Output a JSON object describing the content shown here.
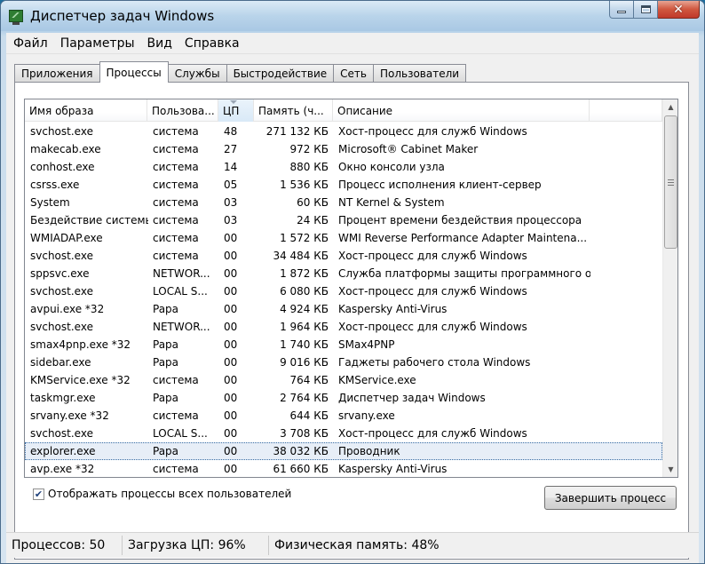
{
  "window": {
    "title": "Диспетчер задач Windows"
  },
  "menu": [
    "Файл",
    "Параметры",
    "Вид",
    "Справка"
  ],
  "tabs": [
    {
      "label": "Приложения"
    },
    {
      "label": "Процессы",
      "active": true
    },
    {
      "label": "Службы"
    },
    {
      "label": "Быстродействие"
    },
    {
      "label": "Сеть"
    },
    {
      "label": "Пользователи"
    }
  ],
  "columns": [
    "Имя образа",
    "Пользова...",
    "ЦП",
    "Память (ч...",
    "Описание"
  ],
  "processes": [
    {
      "name": "svchost.exe",
      "user": "система",
      "cpu": "48",
      "mem": "271 132 КБ",
      "desc": "Хост-процесс для служб Windows"
    },
    {
      "name": "makecab.exe",
      "user": "система",
      "cpu": "27",
      "mem": "972 КБ",
      "desc": "Microsoft® Cabinet Maker"
    },
    {
      "name": "conhost.exe",
      "user": "система",
      "cpu": "14",
      "mem": "880 КБ",
      "desc": "Окно консоли узла"
    },
    {
      "name": "csrss.exe",
      "user": "система",
      "cpu": "05",
      "mem": "1 536 КБ",
      "desc": "Процесс исполнения клиент-сервер"
    },
    {
      "name": "System",
      "user": "система",
      "cpu": "03",
      "mem": "60 КБ",
      "desc": "NT Kernel & System"
    },
    {
      "name": "Бездействие системы",
      "user": "система",
      "cpu": "03",
      "mem": "24 КБ",
      "desc": "Процент времени бездействия процессора"
    },
    {
      "name": "WMIADAP.exe",
      "user": "система",
      "cpu": "00",
      "mem": "1 572 КБ",
      "desc": "WMI Reverse Performance Adapter Maintena..."
    },
    {
      "name": "svchost.exe",
      "user": "система",
      "cpu": "00",
      "mem": "34 484 КБ",
      "desc": "Хост-процесс для служб Windows"
    },
    {
      "name": "sppsvc.exe",
      "user": "NETWOR...",
      "cpu": "00",
      "mem": "1 872 КБ",
      "desc": "Служба платформы защиты программного о..."
    },
    {
      "name": "svchost.exe",
      "user": "LOCAL S...",
      "cpu": "00",
      "mem": "6 080 КБ",
      "desc": "Хост-процесс для служб Windows"
    },
    {
      "name": "avpui.exe *32",
      "user": "Papa",
      "cpu": "00",
      "mem": "4 924 КБ",
      "desc": "Kaspersky Anti-Virus"
    },
    {
      "name": "svchost.exe",
      "user": "NETWOR...",
      "cpu": "00",
      "mem": "1 964 КБ",
      "desc": "Хост-процесс для служб Windows"
    },
    {
      "name": "smax4pnp.exe *32",
      "user": "Papa",
      "cpu": "00",
      "mem": "1 740 КБ",
      "desc": "SMax4PNP"
    },
    {
      "name": "sidebar.exe",
      "user": "Papa",
      "cpu": "00",
      "mem": "9 016 КБ",
      "desc": "Гаджеты рабочего стола Windows"
    },
    {
      "name": "KMService.exe *32",
      "user": "система",
      "cpu": "00",
      "mem": "764 КБ",
      "desc": "KMService.exe"
    },
    {
      "name": "taskmgr.exe",
      "user": "Papa",
      "cpu": "00",
      "mem": "2 764 КБ",
      "desc": "Диспетчер задач Windows"
    },
    {
      "name": "srvany.exe *32",
      "user": "система",
      "cpu": "00",
      "mem": "644 КБ",
      "desc": "srvany.exe"
    },
    {
      "name": "svchost.exe",
      "user": "LOCAL S...",
      "cpu": "00",
      "mem": "3 708 КБ",
      "desc": "Хост-процесс для служб Windows"
    },
    {
      "name": "explorer.exe",
      "user": "Papa",
      "cpu": "00",
      "mem": "38 032 КБ",
      "desc": "Проводник",
      "selected": true
    },
    {
      "name": "avp.exe *32",
      "user": "система",
      "cpu": "00",
      "mem": "61 660 КБ",
      "desc": "Kaspersky Anti-Virus"
    }
  ],
  "show_all_label": "Отображать процессы всех пользователей",
  "show_all_checked": true,
  "end_process_label": "Завершить процесс",
  "status": {
    "processes": "Процессов: 50",
    "cpu": "Загрузка ЦП: 96%",
    "memory": "Физическая память: 48%"
  }
}
